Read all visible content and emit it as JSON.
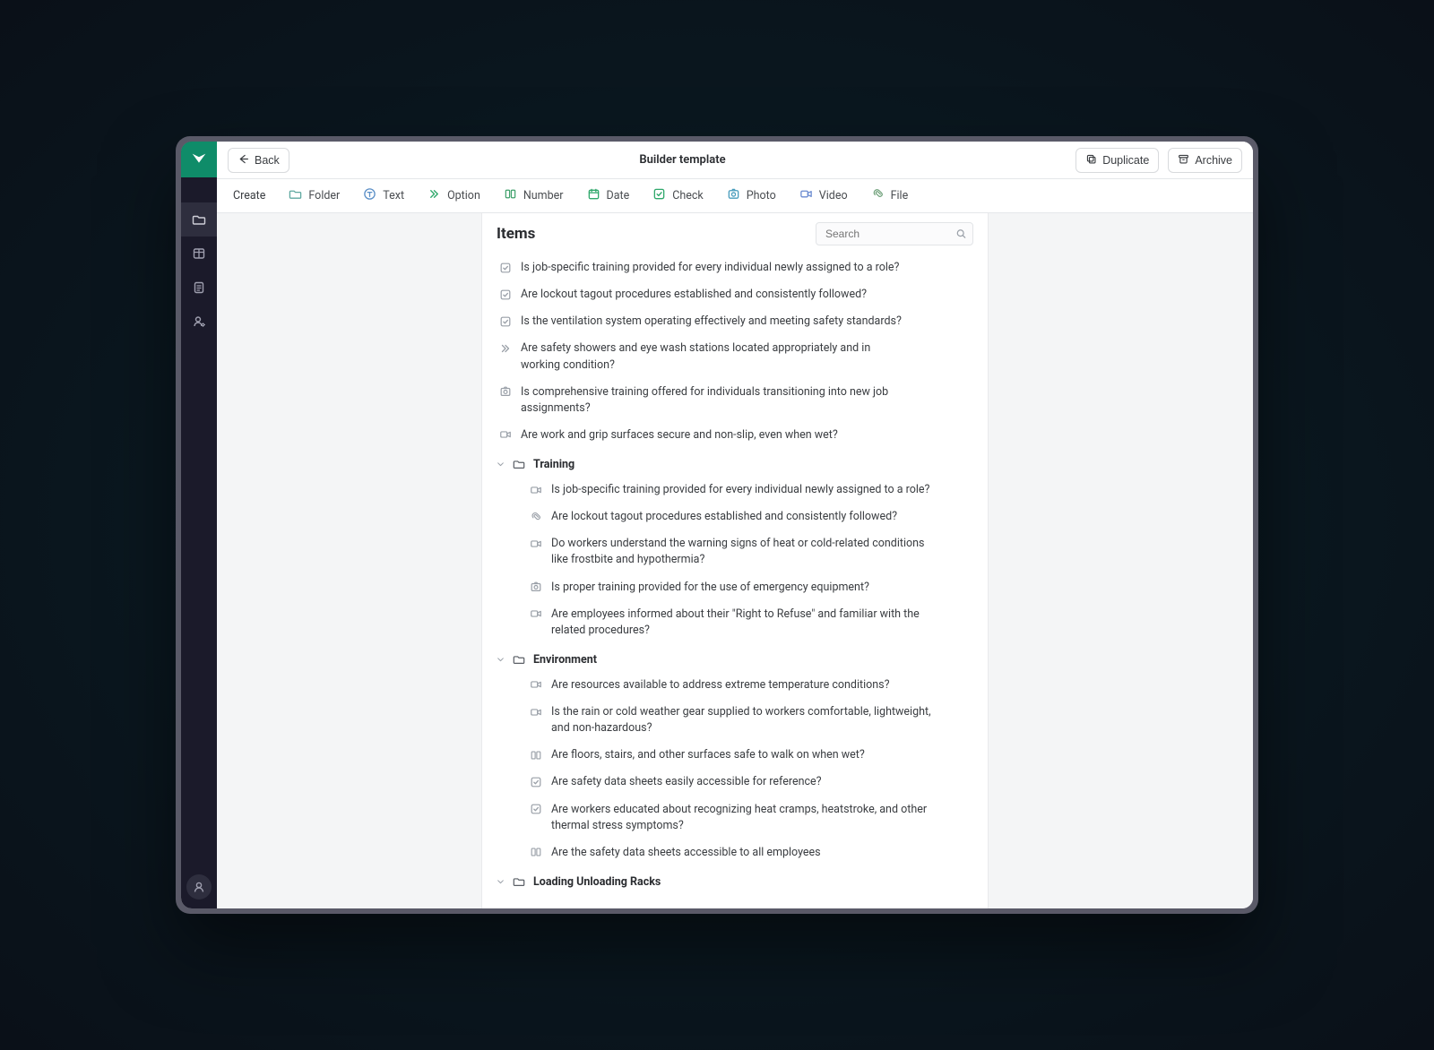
{
  "topbar": {
    "back_label": "Back",
    "title": "Builder template",
    "duplicate_label": "Duplicate",
    "archive_label": "Archive"
  },
  "toolbar": {
    "create": "Create",
    "folder": "Folder",
    "text": "Text",
    "option": "Option",
    "number": "Number",
    "date": "Date",
    "check": "Check",
    "photo": "Photo",
    "video": "Video",
    "file": "File"
  },
  "panel": {
    "title": "Items",
    "search_placeholder": "Search"
  },
  "items": {
    "root": [
      {
        "icon": "check",
        "text": "Is job-specific training provided for every individual newly assigned to a role?"
      },
      {
        "icon": "check",
        "text": "Are lockout tagout procedures established and consistently followed?"
      },
      {
        "icon": "check",
        "text": "Is the ventilation system operating effectively and meeting safety standards?"
      },
      {
        "icon": "option",
        "text": "Are safety showers and eye wash stations located appropriately and in working condition?"
      },
      {
        "icon": "photo",
        "text": "Is comprehensive training offered for individuals transitioning into new job assignments?"
      },
      {
        "icon": "video",
        "text": "Are work and grip surfaces secure and non-slip, even when wet?"
      }
    ],
    "folders": [
      {
        "name": "Training",
        "items": [
          {
            "icon": "video",
            "text": "Is job-specific training provided for every individual newly assigned to a role?"
          },
          {
            "icon": "file",
            "text": "Are lockout tagout procedures established and consistently followed?"
          },
          {
            "icon": "video",
            "text": "Do workers understand the warning signs of heat or cold-related conditions like frostbite and hypothermia?"
          },
          {
            "icon": "photo",
            "text": "Is proper training provided for the use of emergency equipment?"
          },
          {
            "icon": "video",
            "text": "Are employees informed about their \"Right to Refuse\" and familiar with the related procedures?"
          }
        ]
      },
      {
        "name": "Environment",
        "items": [
          {
            "icon": "video",
            "text": "Are resources available to address extreme temperature conditions?"
          },
          {
            "icon": "video",
            "text": "Is the rain or cold weather gear supplied to workers comfortable, lightweight, and non-hazardous?"
          },
          {
            "icon": "number",
            "text": "Are floors, stairs, and other surfaces safe to walk on when wet?"
          },
          {
            "icon": "check",
            "text": "Are safety data sheets easily accessible for reference?"
          },
          {
            "icon": "check",
            "text": "Are workers educated about recognizing heat cramps, heatstroke, and other thermal stress symptoms?"
          },
          {
            "icon": "number",
            "text": "Are the safety data sheets accessible to all employees"
          }
        ]
      },
      {
        "name": "Loading Unloading Racks",
        "items": []
      }
    ]
  }
}
